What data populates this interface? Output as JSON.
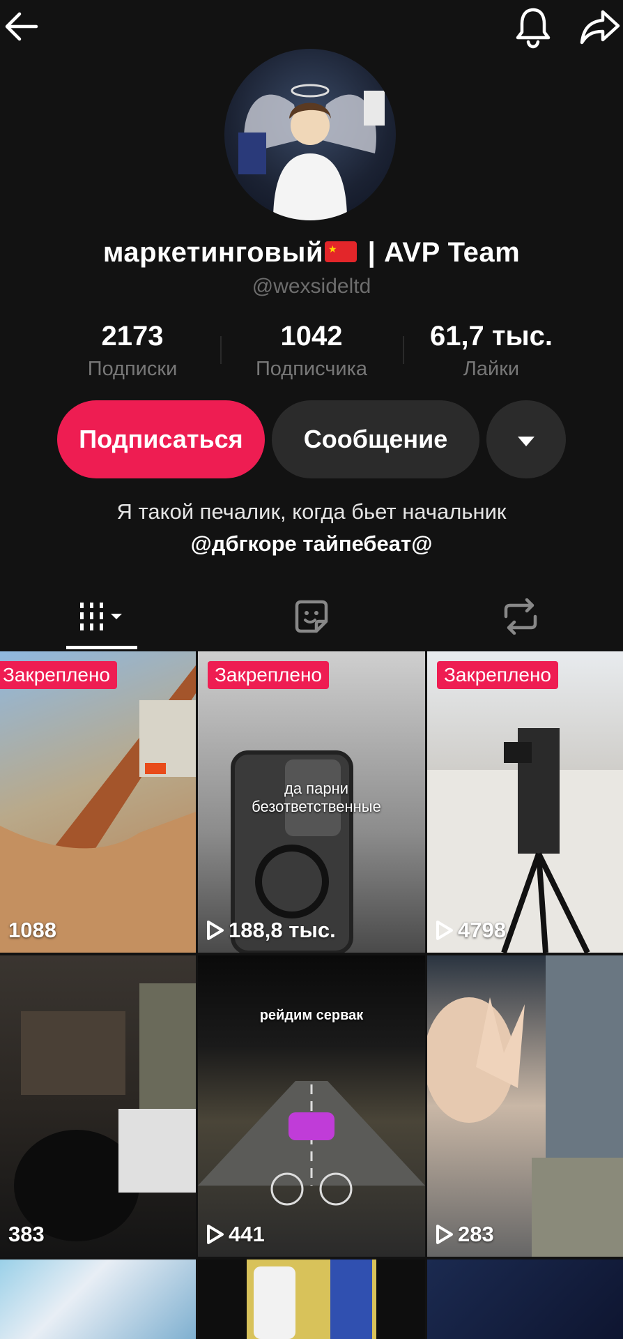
{
  "profile": {
    "name": "маркетинговый",
    "name_suffix": "| AVP Team",
    "handle": "@wexsideltd"
  },
  "stats": [
    {
      "value": "2173",
      "label": "Подписки"
    },
    {
      "value": "1042",
      "label": "Подписчика"
    },
    {
      "value": "61,7 тыс.",
      "label": "Лайки"
    }
  ],
  "buttons": {
    "follow": "Подписаться",
    "message": "Сообщение"
  },
  "bio": {
    "line1": "Я такой печалик, когда бьет начальник",
    "line2": "@дбгкоре тайпебеат@"
  },
  "icons": {
    "back": "arrow-left-icon",
    "bell": "bell-icon",
    "share": "share-icon",
    "more": "caret-down-icon",
    "tab_videos": "grid-icon",
    "tab_favorites": "sticker-icon",
    "tab_reposts": "repost-icon"
  },
  "colors": {
    "background": "#121212",
    "accent": "#ee1d52",
    "secondary_button": "#2b2b2b"
  },
  "videos": [
    {
      "pinned": "Закреплено",
      "views": "1088"
    },
    {
      "pinned": "Закреплено",
      "views": "188,8 тыс.",
      "caption": "да парни безответственные"
    },
    {
      "pinned": "Закреплено",
      "views": "4798"
    },
    {
      "views": "383"
    },
    {
      "views": "441",
      "caption": "рейдим сервак"
    },
    {
      "views": "283"
    }
  ]
}
